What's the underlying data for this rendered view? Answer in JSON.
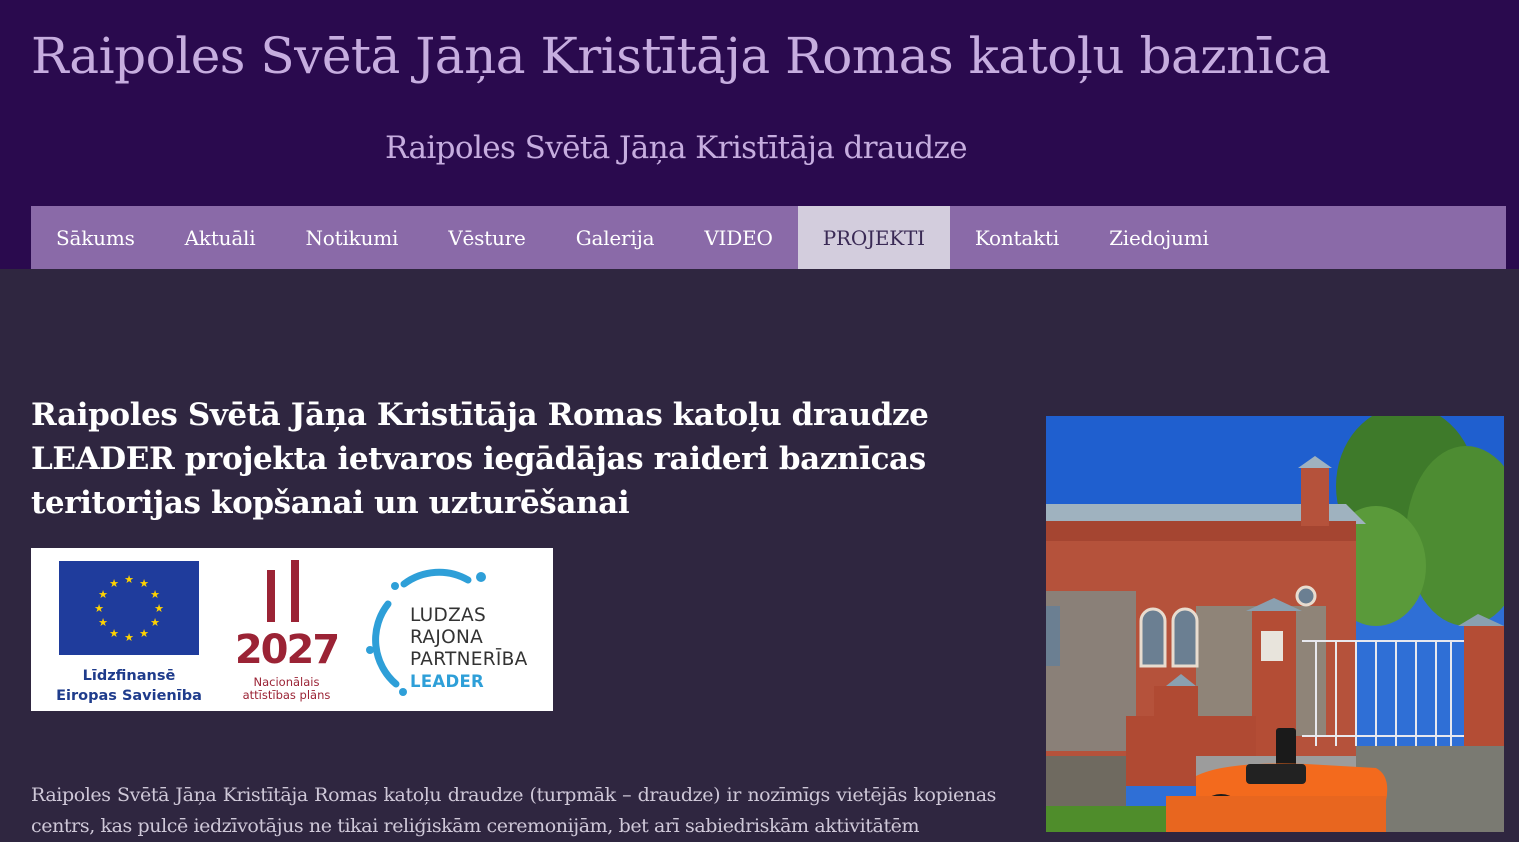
{
  "header": {
    "title": "Raipoles Svētā Jāņa Kristītāja Romas katoļu baznīca",
    "subtitle": "Raipoles Svētā Jāņa Kristītāja draudze"
  },
  "nav": {
    "items": [
      {
        "label": "Sākums"
      },
      {
        "label": "Aktuāli"
      },
      {
        "label": "Notikumi"
      },
      {
        "label": "Vēsture"
      },
      {
        "label": "Galerija"
      },
      {
        "label": "VIDEO"
      },
      {
        "label": "PROJEKTI",
        "active": true
      },
      {
        "label": "Kontakti"
      },
      {
        "label": "Ziedojumi"
      }
    ]
  },
  "article": {
    "title": "Raipoles Svētā Jāņa Kristītāja Romas katoļu draudze LEADER projekta ietvaros iegādājas raideri baznīcas teritorijas kopšanai un uzturēšanai",
    "body": "Raipoles Svētā Jāņa Kristītāja Romas katoļu draudze (turpmāk – draudze) ir nozīmīgs vietējās kopienas centrs, kas pulcē iedzīvotājus ne tikai reliģiskām ceremonijām, bet arī sabiedriskām aktivitātēm"
  },
  "logos": {
    "eu_line1": "Līdzfinansē",
    "eu_line2": "Eiropas Savienība",
    "np_year": "2027",
    "np_line1": "Nacionālais",
    "np_line2": "attīstības plāns",
    "lrp_line1": "LUDZAS",
    "lrp_line2": "RAJONA",
    "lrp_line3": "PARTNERĪBA",
    "lrp_line4": "LEADER"
  },
  "colors": {
    "header_bg": "#2a0a4e",
    "nav_bg": "#8a6aa8",
    "nav_active_bg": "#d3cddd",
    "page_bg": "#2f2640",
    "title_text": "#c6addf"
  }
}
